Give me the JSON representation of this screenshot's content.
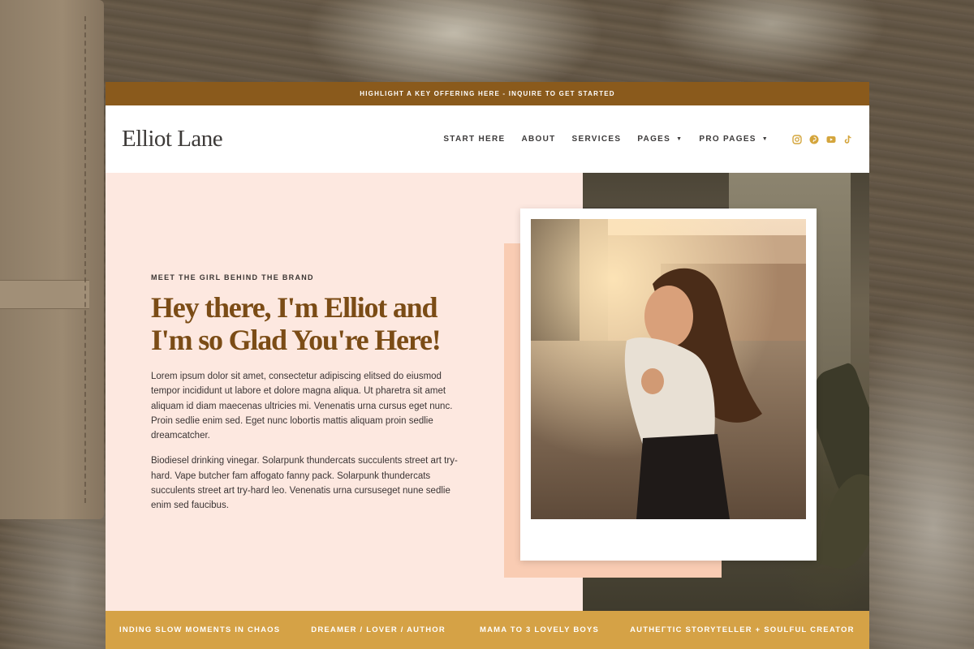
{
  "announcement": "HIGHLIGHT A KEY OFFERING HERE - INQUIRE TO GET STARTED",
  "logo": "Elliot Lane",
  "nav": {
    "items": [
      {
        "label": "START HERE"
      },
      {
        "label": "ABOUT"
      },
      {
        "label": "SERVICES"
      },
      {
        "label": "PAGES",
        "caret": "▼"
      },
      {
        "label": "PRO PAGES",
        "caret": "▼"
      }
    ]
  },
  "social_icons": [
    "instagram-icon",
    "pinterest-icon",
    "youtube-icon",
    "tiktok-icon"
  ],
  "hero": {
    "kicker": "MEET THE GIRL BEHIND THE BRAND",
    "headline_line1": "Hey there, I'm Elliot and",
    "headline_line2": "I'm so Glad You're Here!",
    "paragraph1": "Lorem ipsum dolor sit amet, consectetur adipiscing elitsed do eiusmod tempor incididunt ut labore et dolore magna aliqua. Ut pharetra sit amet aliquam id diam maecenas ultricies mi. Venenatis urna cursus eget nunc. Proin sedlie enim sed. Eget nunc lobortis mattis aliquam proin sedlie dreamcatcher.",
    "paragraph2": "Biodiesel drinking vinegar. Solarpunk thundercats succulents street art try-hard. Vape butcher fam affogato fanny pack. Solarpunk thundercats succulents street art try-hard leo. Venenatis urna cursuseget nune sedlie enim sed faucibus."
  },
  "ribbon": [
    "INDING SLOW MOMENTS IN CHAOS",
    "DREAMER / LOVER / AUTHOR",
    "MAMA TO 3 LOVELY BOYS",
    "AUTHEΓTIC STORYTELLER + SOULFUL CREATOR"
  ],
  "colors": {
    "topbar": "#8a5a1c",
    "headline": "#7b4c16",
    "hero_bg": "#fde8e0",
    "peach_accent": "#f9ccb3",
    "ribbon": "#d5a246",
    "social_icon": "#d4a53c"
  }
}
